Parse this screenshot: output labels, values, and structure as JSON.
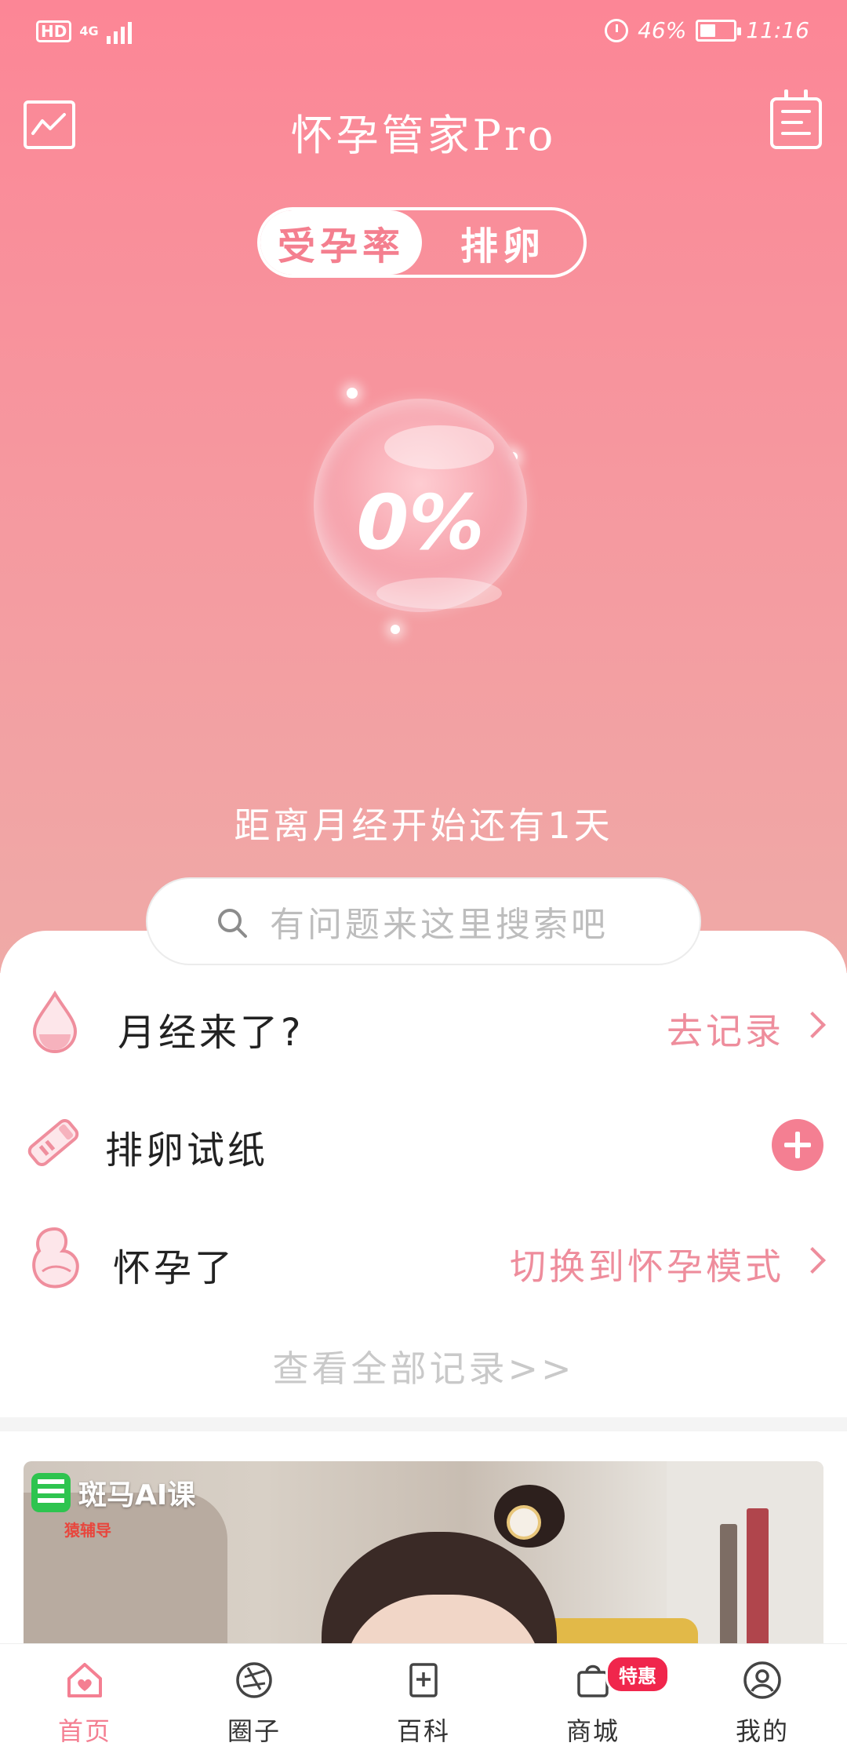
{
  "statusbar": {
    "hd": "HD",
    "network": "4G",
    "battery": "46%",
    "time": "11:16"
  },
  "header": {
    "title": "怀孕管家Pro"
  },
  "toggle": {
    "tab1": "受孕率",
    "tab2": "排卵"
  },
  "bubble": {
    "value": "0%"
  },
  "countdown": "距离月经开始还有1天",
  "search": {
    "placeholder": "有问题来这里搜索吧"
  },
  "records": {
    "period_label": "月经来了?",
    "period_action": "去记录",
    "strip_label": "排卵试纸",
    "pregnant_label": "怀孕了",
    "pregnant_action": "切换到怀孕模式",
    "view_all": "查看全部记录>>"
  },
  "banner": {
    "brand": "斑马AI课",
    "sub": "猿辅导"
  },
  "nav": {
    "items": [
      {
        "label": "首页",
        "icon": "home-heart-icon",
        "active": true
      },
      {
        "label": "圈子",
        "icon": "aperture-icon",
        "active": false
      },
      {
        "label": "百科",
        "icon": "book-plus-icon",
        "active": false
      },
      {
        "label": "商城",
        "icon": "shopping-bag-icon",
        "active": false,
        "badge": "特惠"
      },
      {
        "label": "我的",
        "icon": "user-icon",
        "active": false
      }
    ]
  },
  "colors": {
    "accent": "#f47f92",
    "header_top": "#fc8696",
    "action_text": "#ee8d9c"
  }
}
